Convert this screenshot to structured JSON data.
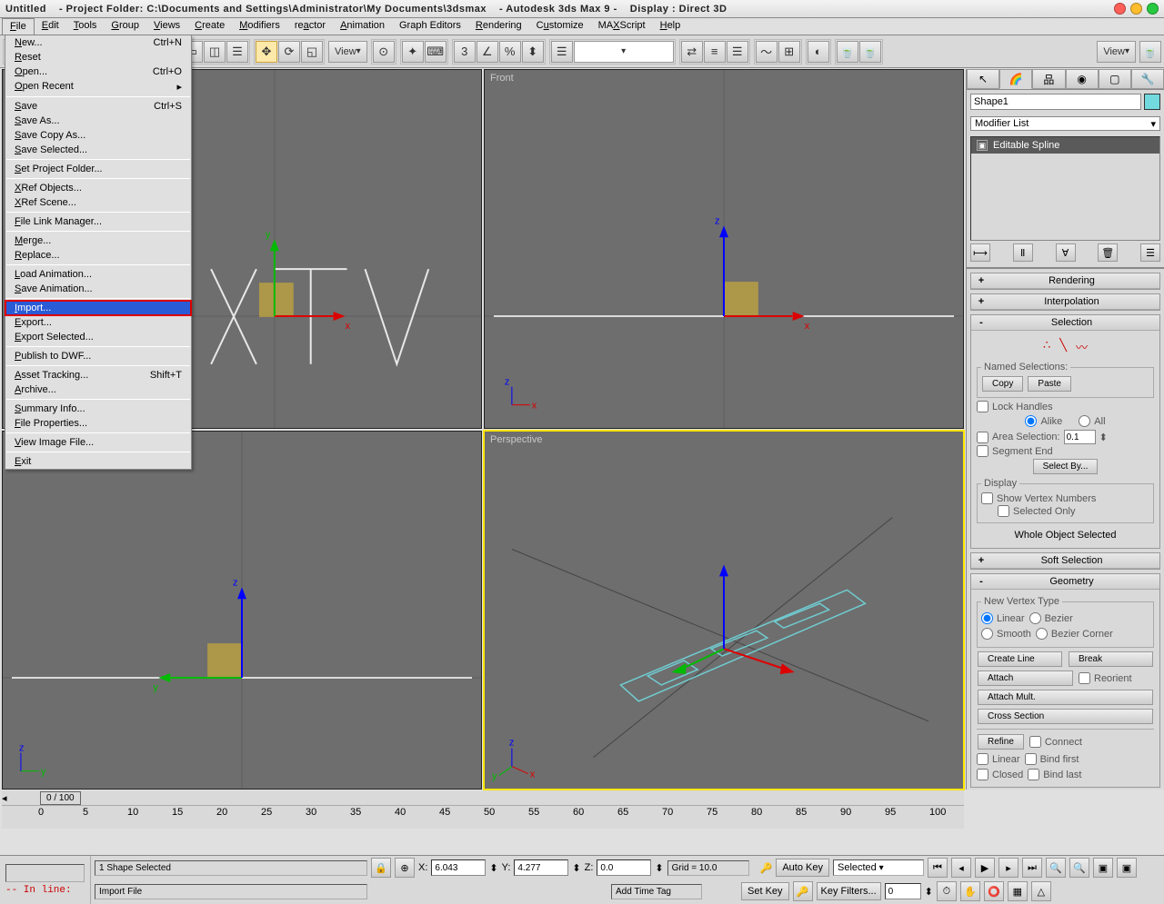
{
  "title": {
    "doc": "Untitled",
    "proj": "- Project Folder: C:\\Documents and Settings\\Administrator\\My Documents\\3dsmax",
    "app": "- Autodesk 3ds Max 9 -",
    "disp": "Display : Direct 3D"
  },
  "menubar": [
    "File",
    "Edit",
    "Tools",
    "Group",
    "Views",
    "Create",
    "Modifiers",
    "reactor",
    "Animation",
    "Graph Editors",
    "Rendering",
    "Customize",
    "MAXScript",
    "Help"
  ],
  "filemenu": [
    {
      "l": "New...",
      "s": "Ctrl+N"
    },
    {
      "l": "Reset"
    },
    {
      "l": "Open...",
      "s": "Ctrl+O"
    },
    {
      "l": "Open Recent",
      "s": "▸"
    },
    "sep",
    {
      "l": "Save",
      "s": "Ctrl+S"
    },
    {
      "l": "Save As..."
    },
    {
      "l": "Save Copy As..."
    },
    {
      "l": "Save Selected..."
    },
    "sep",
    {
      "l": "Set Project Folder..."
    },
    "sep",
    {
      "l": "XRef Objects..."
    },
    {
      "l": "XRef Scene..."
    },
    "sep",
    {
      "l": "File Link Manager..."
    },
    "sep",
    {
      "l": "Merge..."
    },
    {
      "l": "Replace..."
    },
    "sep",
    {
      "l": "Load Animation..."
    },
    {
      "l": "Save Animation..."
    },
    "sep",
    {
      "l": "Import...",
      "hl": true
    },
    {
      "l": "Export..."
    },
    {
      "l": "Export Selected..."
    },
    "sep",
    {
      "l": "Publish to DWF..."
    },
    "sep",
    {
      "l": "Asset Tracking...",
      "s": "Shift+T"
    },
    {
      "l": "Archive..."
    },
    "sep",
    {
      "l": "Summary Info..."
    },
    {
      "l": "File Properties..."
    },
    "sep",
    {
      "l": "View Image File..."
    },
    "sep",
    {
      "l": "Exit"
    }
  ],
  "toolbar": {
    "view_combo": "View",
    "view_combo2": "View"
  },
  "viewports": {
    "tl": "",
    "tr": "Front",
    "bl": "",
    "br": "Perspective"
  },
  "cmd": {
    "name": "Shape1",
    "modlist": "Modifier List",
    "stackitem": "Editable Spline",
    "rollouts": {
      "rendering": "Rendering",
      "interpolation": "Interpolation",
      "selection": "Selection",
      "softsel": "Soft Selection",
      "geometry": "Geometry"
    },
    "sel": {
      "named": "Named Selections:",
      "copy": "Copy",
      "paste": "Paste",
      "lock": "Lock Handles",
      "alike": "Alike",
      "all": "All",
      "area": "Area Selection:",
      "areaval": "0.1",
      "segend": "Segment End",
      "selectby": "Select By...",
      "display": "Display",
      "showvn": "Show Vertex Numbers",
      "selonly": "Selected Only",
      "whole": "Whole Object Selected"
    },
    "geom": {
      "nvt": "New Vertex Type",
      "linear": "Linear",
      "bezier": "Bezier",
      "smooth": "Smooth",
      "bezcor": "Bezier Corner",
      "createline": "Create Line",
      "break": "Break",
      "attach": "Attach",
      "attachmult": "Attach Mult.",
      "reorient": "Reorient",
      "cross": "Cross Section",
      "refine": "Refine",
      "connect": "Connect",
      "linear2": "Linear",
      "bindfirst": "Bind first",
      "closed": "Closed",
      "bindlast": "Bind last"
    }
  },
  "time": {
    "pos": "0 / 100",
    "ticks": [
      "0",
      "5",
      "10",
      "15",
      "20",
      "25",
      "30",
      "35",
      "40",
      "45",
      "50",
      "55",
      "60",
      "65",
      "70",
      "75",
      "80",
      "85",
      "90",
      "95",
      "100"
    ]
  },
  "status": {
    "redline": "-- In line:",
    "selinfo": "1 Shape Selected",
    "x": "6.043",
    "y": "4.277",
    "z": "0.0",
    "grid": "Grid = 10.0",
    "autokey": "Auto Key",
    "setkey": "Set Key",
    "selected": "Selected",
    "keyfilt": "Key Filters...",
    "addtag": "Add Time Tag",
    "prompt": "Import File"
  }
}
